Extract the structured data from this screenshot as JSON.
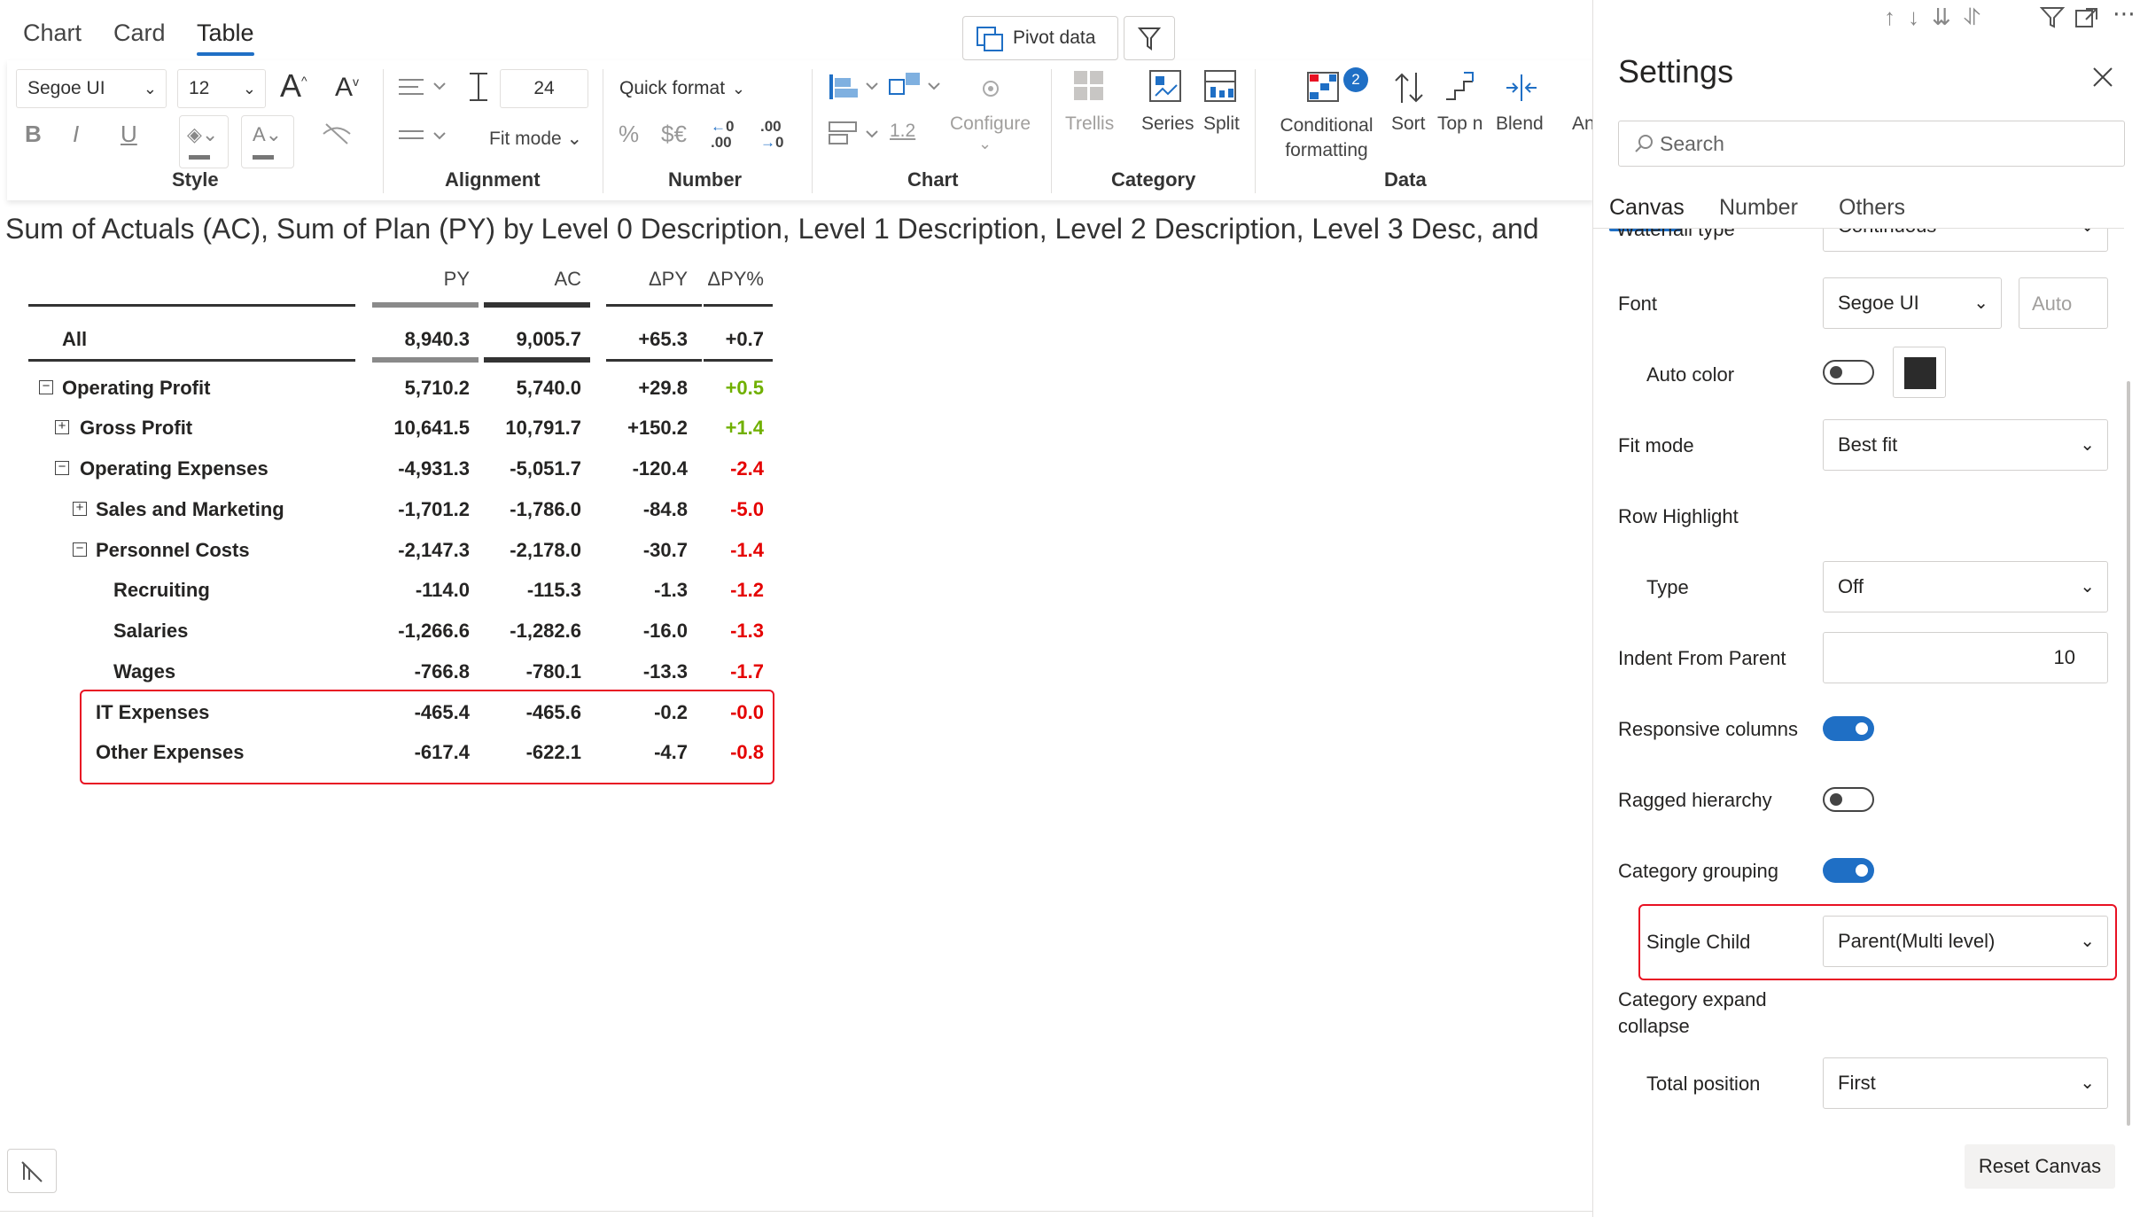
{
  "view_tabs": [
    "Chart",
    "Card",
    "Table"
  ],
  "top_buttons": {
    "pivot_data": "Pivot data"
  },
  "ribbon": {
    "style": {
      "label": "Style",
      "font": "Segoe UI",
      "size": "12",
      "bold": "B",
      "italic": "I",
      "underline": "U"
    },
    "alignment": {
      "label": "Alignment",
      "row_height": "24",
      "fit_mode": "Fit mode"
    },
    "number": {
      "label": "Number",
      "quick_format": "Quick format",
      "percent": "%",
      "currency": "$€",
      "dec_decrease": "←0\n.00",
      "dec_increase": ".00\n→0"
    },
    "chart": {
      "label": "Chart",
      "value": "1.2",
      "configure": "Configure",
      "trellis": "Trellis"
    },
    "category": {
      "label": "Category",
      "series": "Series",
      "split": "Split"
    },
    "data": {
      "label": "Data",
      "conditional_formatting": "Conditional formatting",
      "badge": "2",
      "sort": "Sort",
      "top_n": "Top n",
      "blend": "Blend",
      "more": "An"
    }
  },
  "title": "Sum of Actuals (AC), Sum of Plan (PY) by Level 0 Description, Level 1 Description, Level 2 Description, Level 3 Desc, and",
  "table": {
    "columns": [
      "PY",
      "AC",
      "ΔPY",
      "ΔPY%"
    ],
    "rows": [
      {
        "label": "All",
        "py": "8,940.3",
        "ac": "9,005.7",
        "dpy": "+65.3",
        "dpyp": "+0.7",
        "toggle": ""
      },
      {
        "label": "Operating Profit",
        "py": "5,710.2",
        "ac": "5,740.0",
        "dpy": "+29.8",
        "dpyp": "+0.5",
        "toggle": "−"
      },
      {
        "label": "Gross Profit",
        "py": "10,641.5",
        "ac": "10,791.7",
        "dpy": "+150.2",
        "dpyp": "+1.4",
        "toggle": "+"
      },
      {
        "label": "Operating Expenses",
        "py": "-4,931.3",
        "ac": "-5,051.7",
        "dpy": "-120.4",
        "dpyp": "-2.4",
        "toggle": "−"
      },
      {
        "label": "Sales and Marketing",
        "py": "-1,701.2",
        "ac": "-1,786.0",
        "dpy": "-84.8",
        "dpyp": "-5.0",
        "toggle": "+"
      },
      {
        "label": "Personnel Costs",
        "py": "-2,147.3",
        "ac": "-2,178.0",
        "dpy": "-30.7",
        "dpyp": "-1.4",
        "toggle": "−"
      },
      {
        "label": "Recruiting",
        "py": "-114.0",
        "ac": "-115.3",
        "dpy": "-1.3",
        "dpyp": "-1.2",
        "toggle": ""
      },
      {
        "label": "Salaries",
        "py": "-1,266.6",
        "ac": "-1,282.6",
        "dpy": "-16.0",
        "dpyp": "-1.3",
        "toggle": ""
      },
      {
        "label": "Wages",
        "py": "-766.8",
        "ac": "-780.1",
        "dpy": "-13.3",
        "dpyp": "-1.7",
        "toggle": ""
      },
      {
        "label": "IT Expenses",
        "py": "-465.4",
        "ac": "-465.6",
        "dpy": "-0.2",
        "dpyp": "-0.0",
        "toggle": ""
      },
      {
        "label": "Other Expenses",
        "py": "-617.4",
        "ac": "-622.1",
        "dpy": "-4.7",
        "dpyp": "-0.8",
        "toggle": ""
      }
    ]
  },
  "settings": {
    "title": "Settings",
    "search_placeholder": "Search",
    "tabs": [
      "Canvas",
      "Number",
      "Others"
    ],
    "partial_top": {
      "label": "Waterfall type",
      "value": "Continuous"
    },
    "font": {
      "label": "Font",
      "value": "Segoe UI",
      "size_placeholder": "Auto"
    },
    "auto_color": {
      "label": "Auto color",
      "on": false,
      "swatch": "#2b2b2b"
    },
    "fit_mode": {
      "label": "Fit mode",
      "value": "Best fit"
    },
    "row_highlight": {
      "label": "Row Highlight"
    },
    "type": {
      "label": "Type",
      "value": "Off"
    },
    "indent": {
      "label": "Indent From Parent",
      "value": "10"
    },
    "responsive_columns": {
      "label": "Responsive columns",
      "on": true
    },
    "ragged_hierarchy": {
      "label": "Ragged hierarchy",
      "on": false
    },
    "category_grouping": {
      "label": "Category grouping",
      "on": true
    },
    "single_child": {
      "label": "Single Child",
      "value": "Parent(Multi level)"
    },
    "category_expand_collapse": {
      "label_line1": "Category expand",
      "label_line2": "collapse"
    },
    "total_position": {
      "label": "Total position",
      "value": "First"
    },
    "reset": "Reset Canvas"
  },
  "colors": {
    "accent": "#1f6fc5",
    "negative": "#e50000",
    "positive": "#70b000",
    "highlight_box": "#e81123",
    "py_bar": "#8a8a8a",
    "ac_bar": "#333333"
  }
}
